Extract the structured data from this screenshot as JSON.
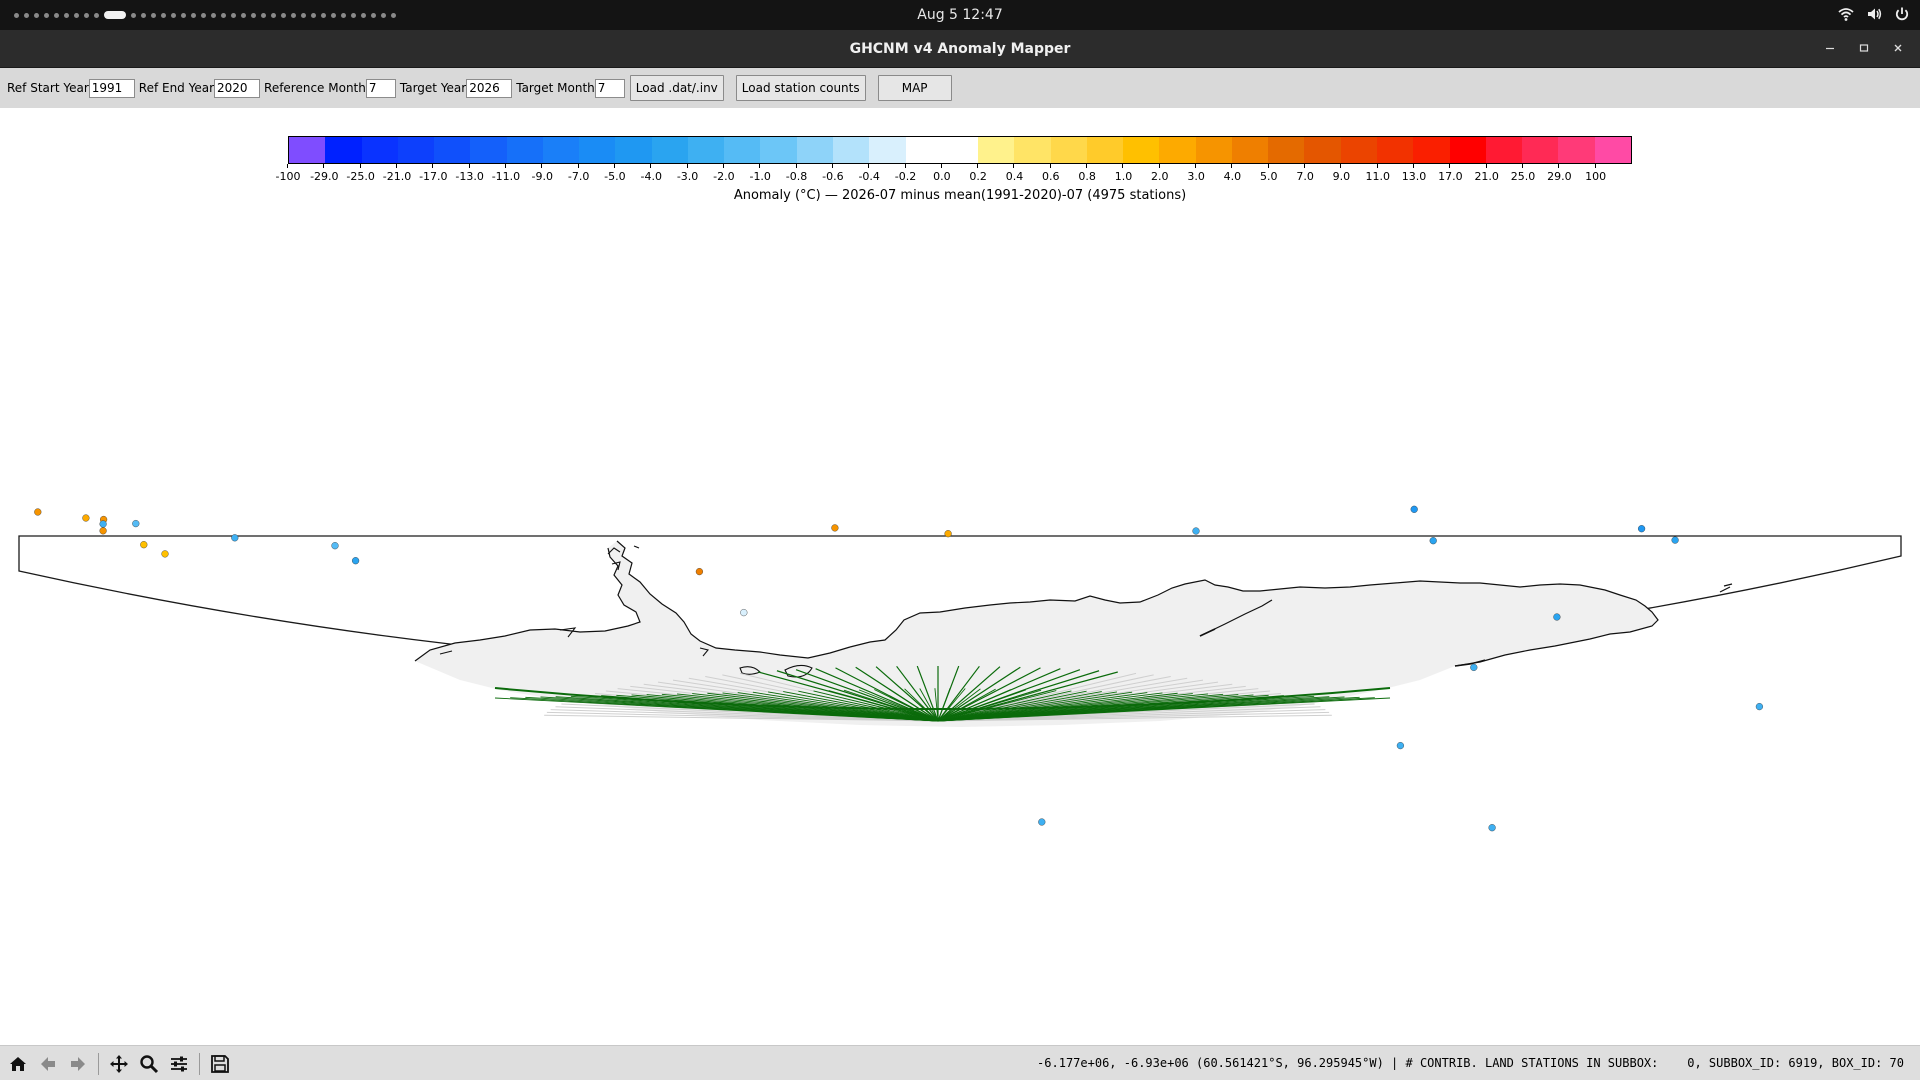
{
  "topbar": {
    "clock": "Aug 5  12:47",
    "workspace_count": 37,
    "active_workspace": 9
  },
  "window": {
    "title": "GHCNM v4 Anomaly Mapper"
  },
  "controls": {
    "ref_start_label": "Ref Start Year",
    "ref_start_value": "1991",
    "ref_end_label": "Ref End Year",
    "ref_end_value": "2020",
    "ref_month_label": "Reference Month",
    "ref_month_value": "7",
    "target_year_label": "Target Year",
    "target_year_value": "2026",
    "target_month_label": "Target Month",
    "target_month_value": "7",
    "load_button": "Load .dat/.inv",
    "load_counts_button": "Load station counts",
    "map_button": "MAP"
  },
  "colorbar": {
    "ticks": [
      "-100",
      "-29.0",
      "-25.0",
      "-21.0",
      "-17.0",
      "-13.0",
      "-11.0",
      "-9.0",
      "-7.0",
      "-5.0",
      "-4.0",
      "-3.0",
      "-2.0",
      "-1.0",
      "-0.8",
      "-0.6",
      "-0.4",
      "-0.2",
      "0.0",
      "0.2",
      "0.4",
      "0.6",
      "0.8",
      "1.0",
      "2.0",
      "3.0",
      "4.0",
      "5.0",
      "7.0",
      "9.0",
      "11.0",
      "13.0",
      "17.0",
      "21.0",
      "25.0",
      "29.0",
      "100"
    ],
    "colors": [
      "#7f4dff",
      "#0021ff",
      "#0a33ff",
      "#0d40fc",
      "#1050fb",
      "#1460fa",
      "#1670f9",
      "#1a7ff8",
      "#1a8cf5",
      "#1f98f2",
      "#2aa4f0",
      "#3eb0f2",
      "#55bbf5",
      "#6cc6f7",
      "#8ed3f9",
      "#b3e2fb",
      "#d9f0fd",
      "#ffffff",
      "#ffffff",
      "#fff28c",
      "#ffe466",
      "#ffd84a",
      "#ffcb2a",
      "#ffc000",
      "#fdaa00",
      "#f69400",
      "#ef7f00",
      "#e46a00",
      "#e45600",
      "#eb4400",
      "#f23200",
      "#fa1f00",
      "#ff0000",
      "#ff1a33",
      "#ff2a55",
      "#ff3a78",
      "#ff4aa5"
    ],
    "label": "Anomaly (°C) — 2026-07 minus mean(1991-2020)-07 (4975 stations)"
  },
  "map": {
    "title": "",
    "stations": [
      {
        "lon": -63.5,
        "lat": -64.8,
        "anomaly": 3.0
      },
      {
        "lon": -65.2,
        "lat": -63.2,
        "anomaly": 3.0
      },
      {
        "lon": -64.1,
        "lat": -64.4,
        "anomaly": 2.0
      },
      {
        "lon": -66.0,
        "lat": -65.3,
        "anomaly": 3.0
      },
      {
        "lon": -67.1,
        "lat": -66.7,
        "anomaly": 1.0
      },
      {
        "lon": -68.2,
        "lat": -67.5,
        "anomaly": 1.0
      },
      {
        "lon": -64.5,
        "lat": -65.0,
        "anomaly": -3.0
      },
      {
        "lon": -62.7,
        "lat": -65.6,
        "anomaly": -2.0
      },
      {
        "lon": -60.2,
        "lat": -68.1,
        "anomaly": -3.0
      },
      {
        "lon": -57.8,
        "lat": -71.4,
        "anomaly": -4.0
      },
      {
        "lon": -55.4,
        "lat": -70.2,
        "anomaly": -2.0
      },
      {
        "lon": -26.6,
        "lat": -75.6,
        "anomaly": 4.0
      },
      {
        "lon": -8.3,
        "lat": -70.7,
        "anomaly": 3.0
      },
      {
        "lon": 0.8,
        "lat": -70.4,
        "anomaly": 2.0
      },
      {
        "lon": 22.4,
        "lat": -71.7,
        "anomaly": -3.0
      },
      {
        "lon": 37.8,
        "lat": -69.0,
        "anomaly": -5.0
      },
      {
        "lon": 45.7,
        "lat": -71.3,
        "anomaly": -4.0
      },
      {
        "lon": 58.1,
        "lat": -67.6,
        "anomaly": -5.0
      },
      {
        "lon": 62.8,
        "lat": -67.6,
        "anomaly": -4.0
      },
      {
        "lon": 78.0,
        "lat": -72.9,
        "anomaly": -4.0
      },
      {
        "lon": 93.0,
        "lat": -75.5,
        "anomaly": -3.0
      },
      {
        "lon": 110.5,
        "lat": -66.3,
        "anomaly": -3.0
      },
      {
        "lon": 123.0,
        "lat": -75.1,
        "anomaly": -3.0
      },
      {
        "lon": 140.0,
        "lat": -66.7,
        "anomaly": -3.0
      },
      {
        "lon": 166.7,
        "lat": -77.8,
        "anomaly": -3.0
      },
      {
        "lon": -30.0,
        "lat": -79.5,
        "anomaly": -0.4
      }
    ]
  },
  "status": {
    "coordinates": "-6.177e+06, -6.93e+06 (60.561421°S, 96.295945°W) | # CONTRIB. LAND STATIONS IN SUBBOX:    0, SUBBOX_ID: 6919, BOX_ID: 70"
  },
  "mpl_toolbar": {
    "tools": [
      "home-icon",
      "back-arrow-icon",
      "forward-arrow-icon",
      "pan-icon",
      "zoom-icon",
      "configure-subplots-icon",
      "save-icon"
    ]
  }
}
